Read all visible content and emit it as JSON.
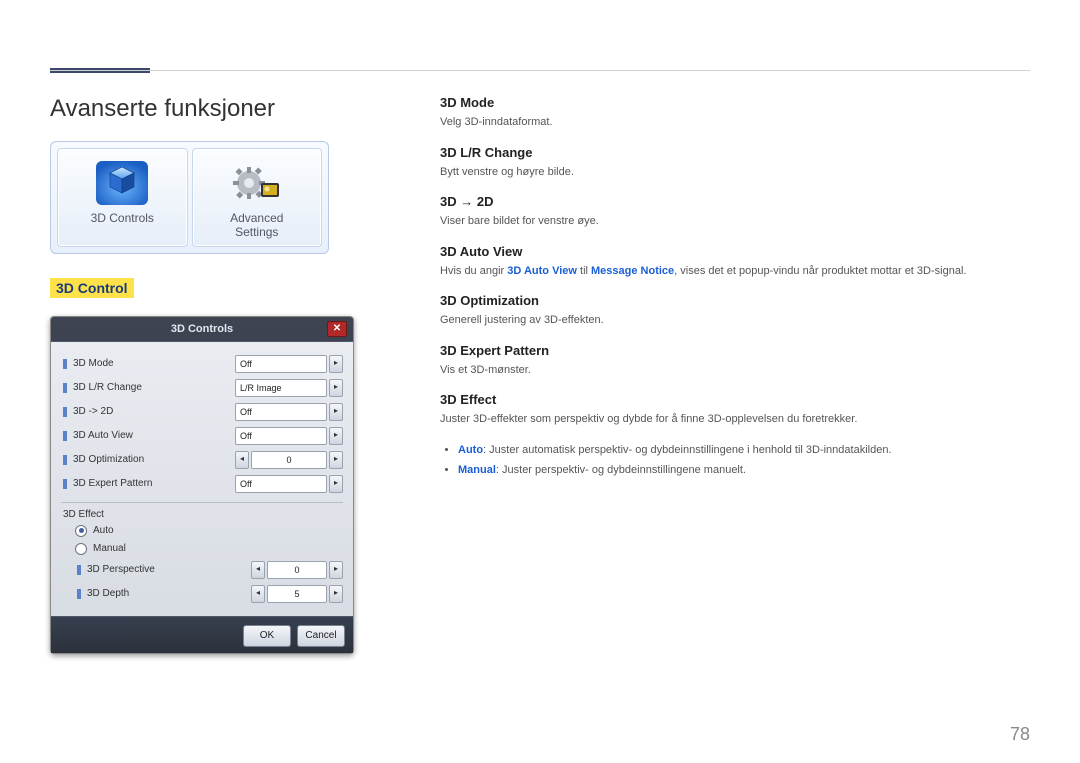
{
  "page": {
    "title": "Avanserte funksjoner",
    "number": "78"
  },
  "launcher": {
    "card1": {
      "label": "3D Controls"
    },
    "card2": {
      "label1": "Advanced",
      "label2": "Settings"
    }
  },
  "section_label": "3D Control",
  "dialog": {
    "title": "3D Controls",
    "rows": {
      "r1": {
        "label": "3D Mode",
        "value": "Off"
      },
      "r2": {
        "label": "3D L/R Change",
        "value": "L/R Image"
      },
      "r3": {
        "label": "3D -> 2D",
        "value": "Off"
      },
      "r4": {
        "label": "3D Auto View",
        "value": "Off"
      },
      "r5": {
        "label": "3D Optimization",
        "value": "0"
      },
      "r6": {
        "label": "3D Expert Pattern",
        "value": "Off"
      }
    },
    "effect_group": "3D Effect",
    "radio_auto": "Auto",
    "radio_manual": "Manual",
    "sub": {
      "s1": {
        "label": "3D Perspective",
        "value": "0"
      },
      "s2": {
        "label": "3D Depth",
        "value": "5"
      }
    },
    "ok": "OK",
    "cancel": "Cancel"
  },
  "features": {
    "f1": {
      "h": "3D Mode",
      "p": "Velg 3D-inndataformat."
    },
    "f2": {
      "h": "3D L/R Change",
      "p": "Bytt venstre og høyre bilde."
    },
    "f3": {
      "h": "3D → 2D",
      "p": "Viser bare bildet for venstre øye."
    },
    "f4": {
      "h": "3D Auto View",
      "pre": "Hvis du angir ",
      "post": ", vises det et popup-vindu når produktet mottar et 3D-signal.",
      "kw1": "3D Auto View",
      "mid": " til ",
      "kw2": "Message Notice"
    },
    "f5": {
      "h": "3D Optimization",
      "p": "Generell justering av 3D-effekten."
    },
    "f6": {
      "h": "3D Expert Pattern",
      "p": "Vis et 3D-mønster."
    },
    "f7": {
      "h": "3D Effect",
      "p": "Juster 3D-effekter som perspektiv og dybde for å finne 3D-opplevelsen du foretrekker.",
      "b1_kw": "Auto",
      "b1": ": Juster automatisk perspektiv- og dybdeinnstillingene i henhold til 3D-inndatakilden.",
      "b2_kw": "Manual",
      "b2": ": Juster perspektiv- og dybdeinnstillingene manuelt."
    }
  }
}
